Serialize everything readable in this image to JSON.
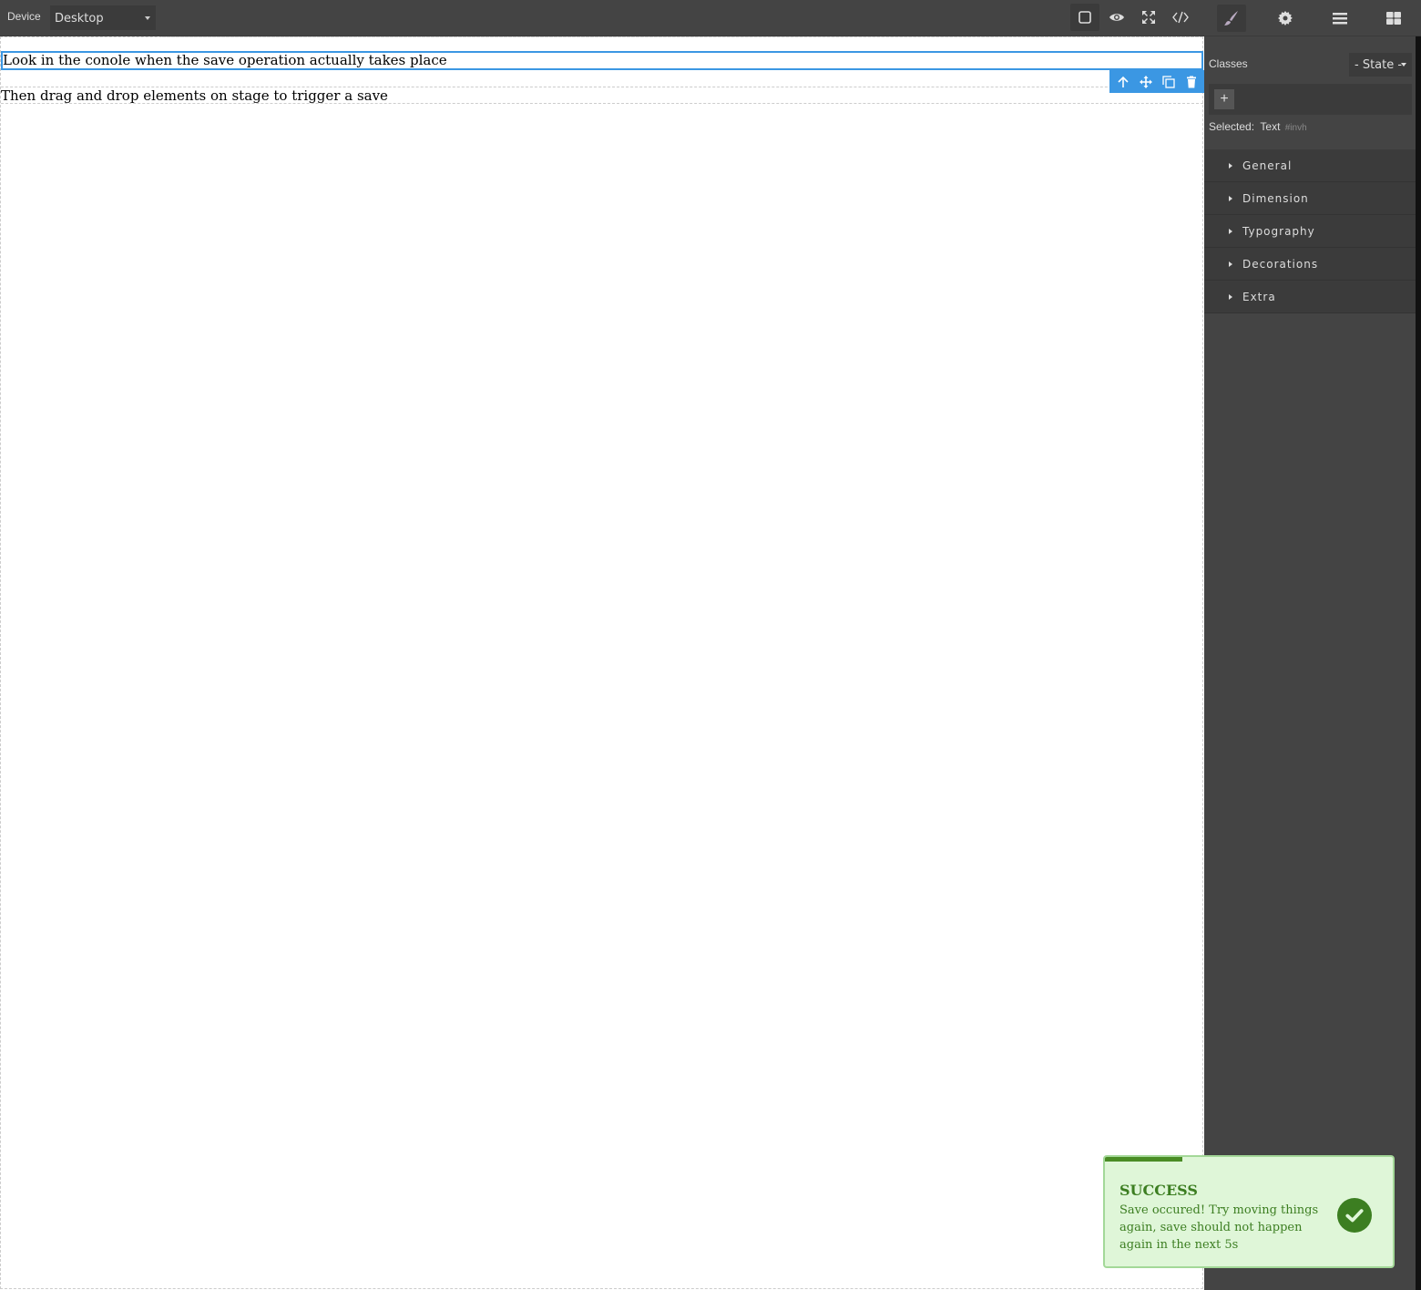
{
  "topbar": {
    "device_label": "Device",
    "device_value": "Desktop",
    "tools": [
      {
        "name": "sw-visibility",
        "icon": "square-outline-icon",
        "active": true
      },
      {
        "name": "preview",
        "icon": "eye-icon",
        "active": false
      },
      {
        "name": "fullscreen",
        "icon": "expand-icon",
        "active": false
      },
      {
        "name": "export-code",
        "icon": "code-icon",
        "active": false
      }
    ]
  },
  "panel_tabs": [
    {
      "name": "style-manager",
      "icon": "paintbrush-icon",
      "active": true
    },
    {
      "name": "settings",
      "icon": "gear-icon",
      "active": false
    },
    {
      "name": "layer-manager",
      "icon": "bars-icon",
      "active": false
    },
    {
      "name": "blocks",
      "icon": "grid-icon",
      "active": false
    }
  ],
  "canvas": {
    "texts": [
      "Look in the conole when the save operation actually takes place",
      "Then drag and drop elements on stage to trigger a save"
    ],
    "selection_toolbar": [
      "arrow-up-icon",
      "move-icon",
      "clone-icon",
      "trash-icon"
    ]
  },
  "style_panel": {
    "classes_label": "Classes",
    "state_value": "- State -",
    "add_class_label": "+",
    "selected_label": "Selected:",
    "selected_name": "Text",
    "selected_id": "#invh",
    "sectors": [
      "General",
      "Dimension",
      "Typography",
      "Decorations",
      "Extra"
    ]
  },
  "toast": {
    "title": "SUCCESS",
    "message": "Save occured! Try moving things again, save should not happen again in the next 5s",
    "progress_fraction": 0.27,
    "colors": {
      "bg": "#dff6d8",
      "text": "#3c7e21",
      "border": "#a3d898"
    }
  }
}
